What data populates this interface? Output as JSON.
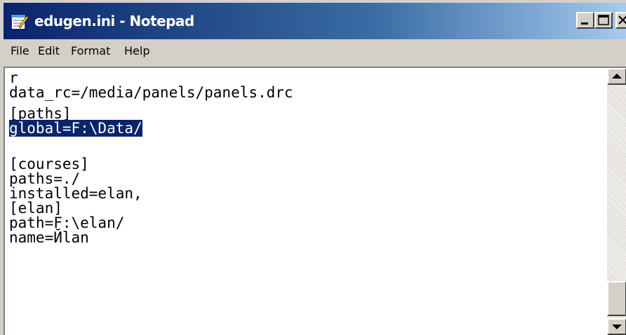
{
  "window": {
    "title": "edugen.ini - Notepad",
    "title_bar_colors": [
      "#0a246a",
      "#a6caf0"
    ],
    "selection_color": "#0a246a",
    "icon": "notepad-icon",
    "controls": [
      "minimize-icon",
      "maximize-icon",
      "close-icon"
    ]
  },
  "menu": {
    "file": "File",
    "edit": "Edit",
    "format": "Format",
    "help": "Help"
  },
  "editor": {
    "lines": {
      "l1": "r",
      "l2": "data_rc=/media/panels/panels.drc",
      "l3": "[paths]",
      "l4_selected": "global=F:\\Data/",
      "l5": "[courses]",
      "l6": "paths=./",
      "l7": "installed=elan,",
      "l8": "[elan]",
      "l9": "path=F:\\elan/",
      "l10": "name=Йlan"
    },
    "selected_line": "global=F:\\Data/"
  },
  "scrollbar": {
    "position_fraction": 0.92,
    "up_arrow": "scroll-up-arrow-icon",
    "down_arrow": "scroll-down-arrow-icon"
  }
}
